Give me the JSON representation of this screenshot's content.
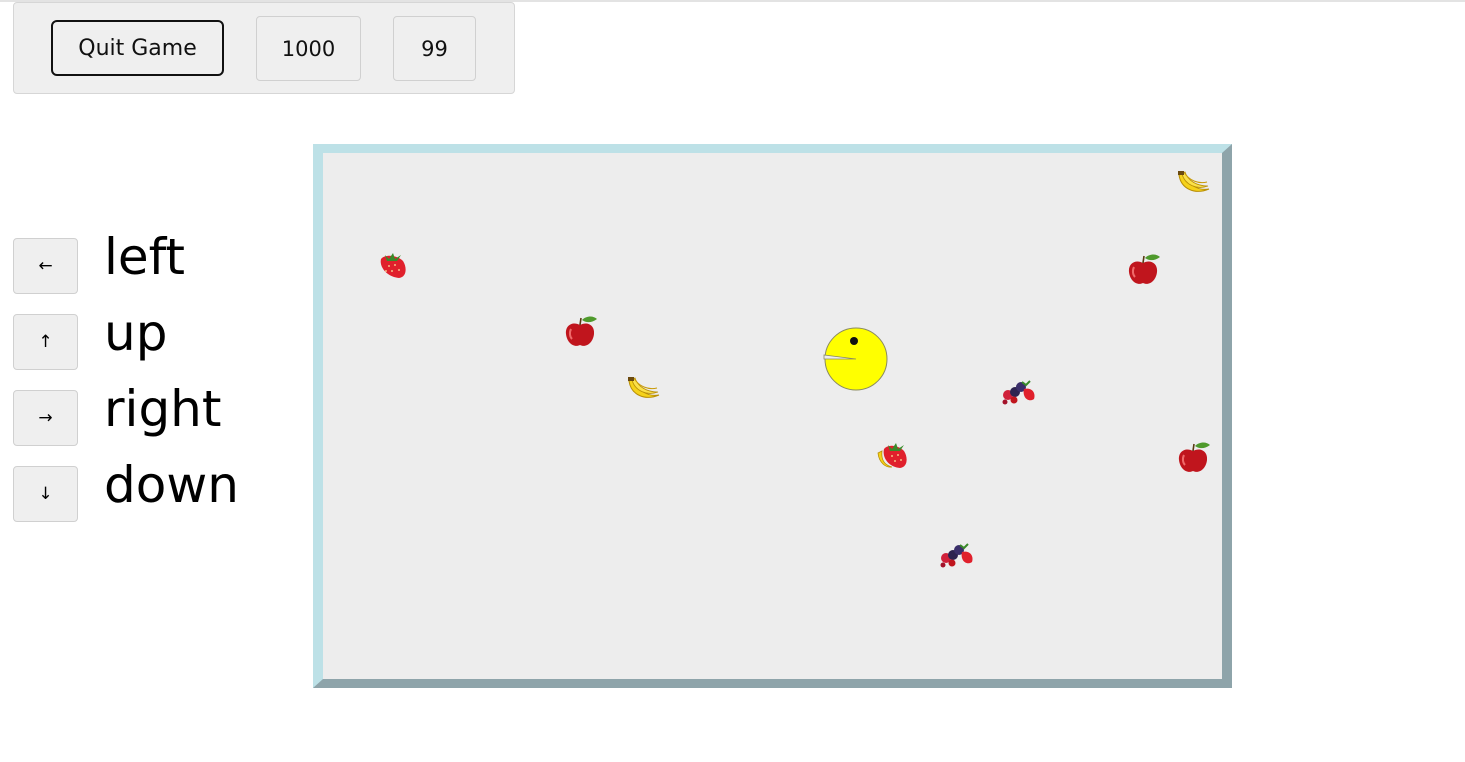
{
  "toolbar": {
    "quit_label": "Quit Game",
    "score": "1000",
    "lives": "99"
  },
  "controls": [
    {
      "arrow": "←",
      "label": "left"
    },
    {
      "arrow": "↑",
      "label": "up"
    },
    {
      "arrow": "→",
      "label": "right"
    },
    {
      "arrow": "↓",
      "label": "down"
    }
  ],
  "board": {
    "player": "pacman",
    "fruits": [
      "banana",
      "strawberry",
      "apple",
      "apple",
      "banana",
      "berries",
      "strawberry",
      "apple",
      "berries"
    ]
  },
  "colors": {
    "board_bg": "#ededed",
    "pacman": "#ffff00",
    "apple": "#c0151d",
    "strawberry": "#e0202c",
    "banana": "#f5d21a"
  }
}
